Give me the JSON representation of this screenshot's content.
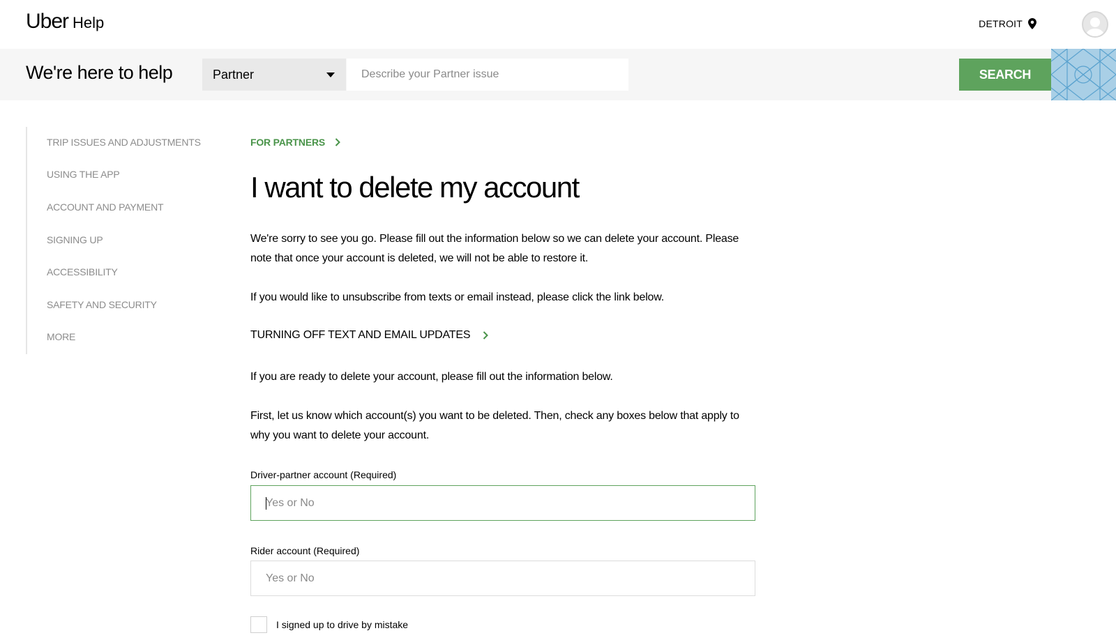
{
  "header": {
    "logo": "Uber",
    "logo_suffix": "Help",
    "city": "DETROIT",
    "location_icon": "map-pin-icon",
    "avatar_icon": "user-avatar-icon"
  },
  "search_band": {
    "title": "We're here to help",
    "category_selected": "Partner",
    "search_placeholder": "Describe your Partner issue",
    "search_button": "SEARCH"
  },
  "sidebar": {
    "items": [
      {
        "label": "TRIP ISSUES AND ADJUSTMENTS"
      },
      {
        "label": "USING THE APP"
      },
      {
        "label": "ACCOUNT AND PAYMENT"
      },
      {
        "label": "SIGNING UP"
      },
      {
        "label": "ACCESSIBILITY"
      },
      {
        "label": "SAFETY AND SECURITY"
      },
      {
        "label": "MORE"
      }
    ]
  },
  "main": {
    "breadcrumb": "FOR PARTNERS",
    "title": "I want to delete my account",
    "intro": "We're sorry to see you go. Please fill out the information below so we can delete your account. Please note that once your account is deleted, we will not be able to restore it.",
    "unsubscribe_note": "If you would like to unsubscribe from texts or email instead, please click the link below.",
    "unsubscribe_link": "TURNING OFF TEXT AND EMAIL UPDATES",
    "ready_note": "If you are ready to delete your account, please fill out the information below.",
    "instructions": "First, let us know which account(s) you want to be deleted. Then, check any boxes below that apply to why you want to delete your account.",
    "fields": [
      {
        "label": "Driver-partner account (Required)",
        "placeholder": "Yes or No",
        "value": ""
      },
      {
        "label": "Rider account (Required)",
        "placeholder": "Yes or No",
        "value": ""
      }
    ],
    "checkbox_label": "I signed up to drive by mistake"
  },
  "colors": {
    "accent_green": "#5ea35d",
    "link_green": "#4a944a",
    "band_background": "#f6f6f6",
    "pattern_blue": "#a9cfe6"
  }
}
